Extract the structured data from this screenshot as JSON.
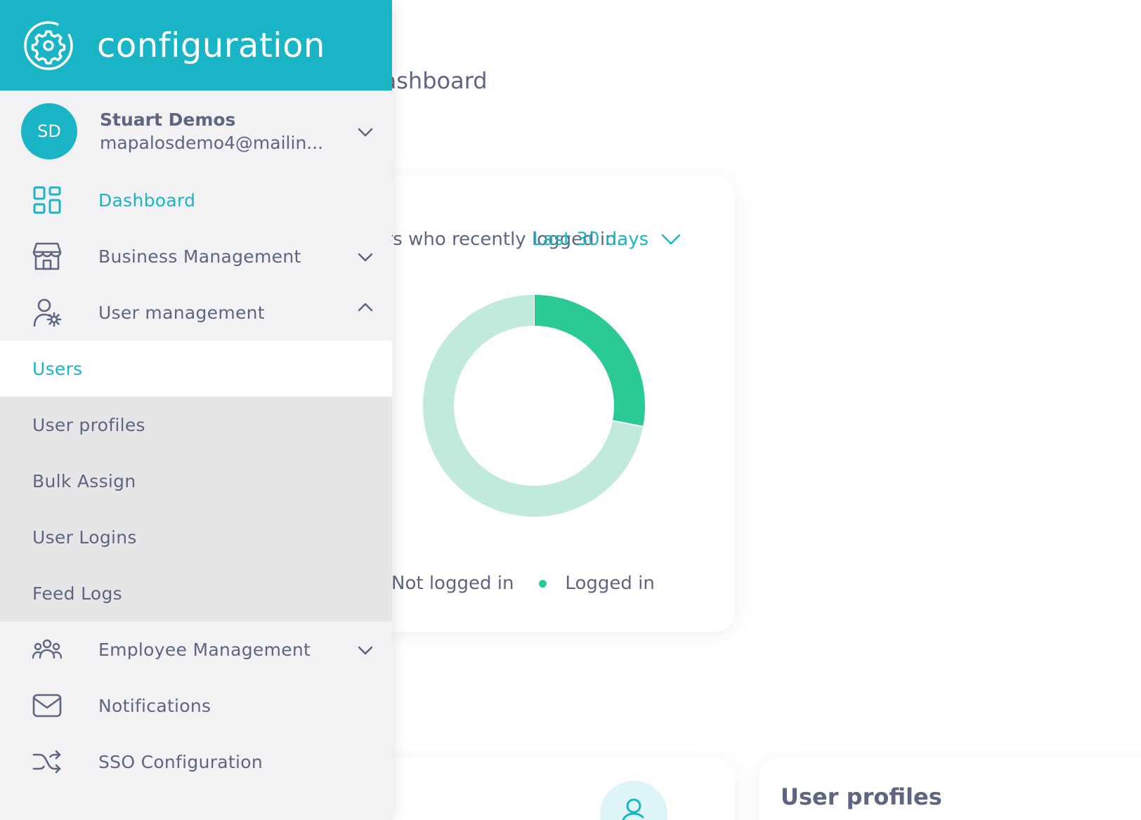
{
  "main": {
    "page_title": "Dashboard",
    "logins_card": {
      "description": "Users who recently logged in.",
      "range_select": "Last 30 days",
      "legend": [
        {
          "label": "Not logged in",
          "color": "#bfeadc"
        },
        {
          "label": "Logged in",
          "color": "#2bc994"
        }
      ]
    },
    "profiles_card": {
      "title": "User profiles"
    }
  },
  "chart_data": {
    "type": "pie",
    "title": "",
    "labels": [
      "Logged in",
      "Not logged in"
    ],
    "values": [
      28,
      72
    ],
    "colors": [
      "#2bc994",
      "#bfeadc"
    ],
    "donut": true
  },
  "sidebar": {
    "brand": {
      "name": "configuration",
      "icon": "gear-icon"
    },
    "user": {
      "initials": "SD",
      "name": "Stuart Demos",
      "email": "mapalosdemo4@mailin..."
    },
    "items": [
      {
        "label": "Dashboard",
        "icon": "dashboard-icon",
        "active": true
      },
      {
        "label": "Business Management",
        "icon": "store-icon",
        "expandable": true
      },
      {
        "label": "User management",
        "icon": "user-settings-icon",
        "expanded": true
      },
      {
        "label": "Employee Management",
        "icon": "people-icon",
        "expandable": true
      },
      {
        "label": "Notifications",
        "icon": "mail-icon"
      },
      {
        "label": "SSO Configuration",
        "icon": "shuffle-icon"
      }
    ],
    "user_management_sub": [
      {
        "label": "Users",
        "active": true
      },
      {
        "label": "User profiles"
      },
      {
        "label": "Bulk Assign"
      },
      {
        "label": "User Logins"
      },
      {
        "label": "Feed Logs"
      }
    ]
  },
  "colors": {
    "accent": "#19b5c6",
    "text": "#5d6580",
    "sidebar_bg": "#f2f2f4",
    "submenu_bg": "#e6e6e8"
  }
}
